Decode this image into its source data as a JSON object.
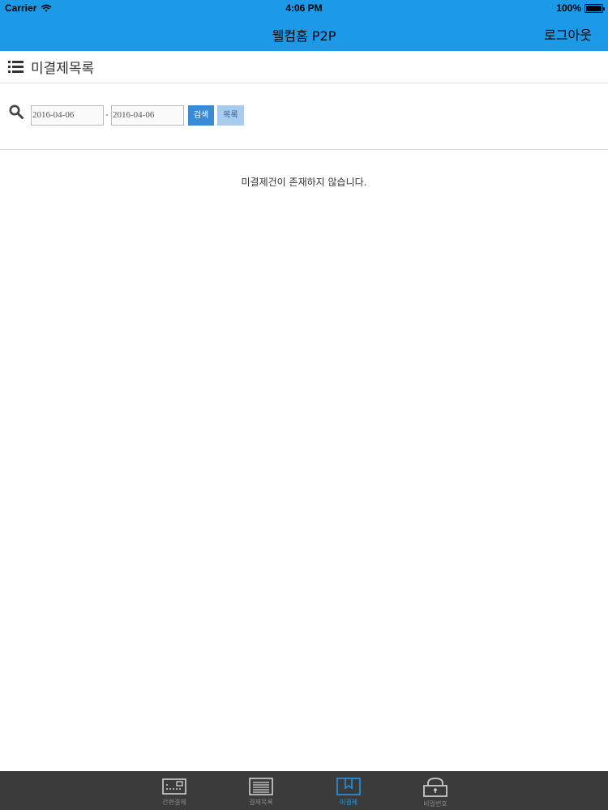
{
  "status_bar": {
    "carrier": "Carrier",
    "time": "4:06 PM",
    "battery": "100%"
  },
  "nav": {
    "title": "웰컴홈 P2P",
    "logout": "로그아웃"
  },
  "section": {
    "title": "미결제목록"
  },
  "search": {
    "start_date": "2016-04-06",
    "separator": "-",
    "end_date": "2016-04-06",
    "search_label": "검색",
    "list_label": "목록"
  },
  "empty_message": "미결제건이 존재하지 않습니다.",
  "tabs": [
    {
      "label": "간편결제",
      "icon": "card-reader-icon",
      "active": false
    },
    {
      "label": "결제목록",
      "icon": "receipt-list-icon",
      "active": false
    },
    {
      "label": "미결제",
      "icon": "pending-bookmark-icon",
      "active": true
    },
    {
      "label": "비밀번호",
      "icon": "lock-icon",
      "active": false
    }
  ],
  "colors": {
    "accent": "#1c9ae8",
    "tabbar": "#3b3b3b",
    "search_button": "#3a8ad6",
    "list_button": "#a9cbed"
  }
}
